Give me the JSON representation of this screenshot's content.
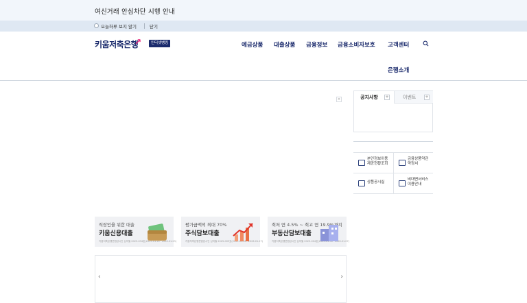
{
  "notice": {
    "title": "여신거래 안심차단 시행 안내",
    "dont_show_today": "오늘하루 보지 않기",
    "close": "닫기"
  },
  "header": {
    "logo": "키움저축은행",
    "badge": "인터넷뱅킹",
    "nav": [
      "예금상품",
      "대출상품",
      "금융정보",
      "금융소비자보호",
      "고객센터",
      "은행소개"
    ]
  },
  "board": {
    "tabs": [
      "공지사항",
      "이벤트"
    ],
    "plus": "+"
  },
  "quick_menu": [
    {
      "line1": "본인정보이용",
      "line2": "제공현황조회"
    },
    {
      "line1": "금융상품약관",
      "line2": "약정서"
    },
    {
      "line1": "상품공시실",
      "line2": ""
    },
    {
      "line1": "비대면서비스",
      "line2": "이용안내"
    }
  ],
  "banners": [
    {
      "sub": "직장인을 위한 대출",
      "title": "키움신용대출",
      "foot": "키움저축은행준법감시인 심의필 2025-034호(2025.01.24~2026.01.23)"
    },
    {
      "sub": "평가금액의 최대 70%",
      "title": "주식담보대출",
      "foot": "키움저축은행준법감시인 심의필 2025-009호(2025.01.28~2026.01.27)"
    },
    {
      "sub": "최저 연 4.5% ~ 최고 연 19.9%까지",
      "title": "부동산담보대출",
      "foot": "키움저축은행준법감시인 심의필 2025-004호(2025.01.08~2026.01.07)"
    }
  ],
  "slider": {
    "prev": "‹",
    "next": "›"
  },
  "colors": {
    "brand": "#1a2a6c",
    "accent": "#e61e78"
  }
}
